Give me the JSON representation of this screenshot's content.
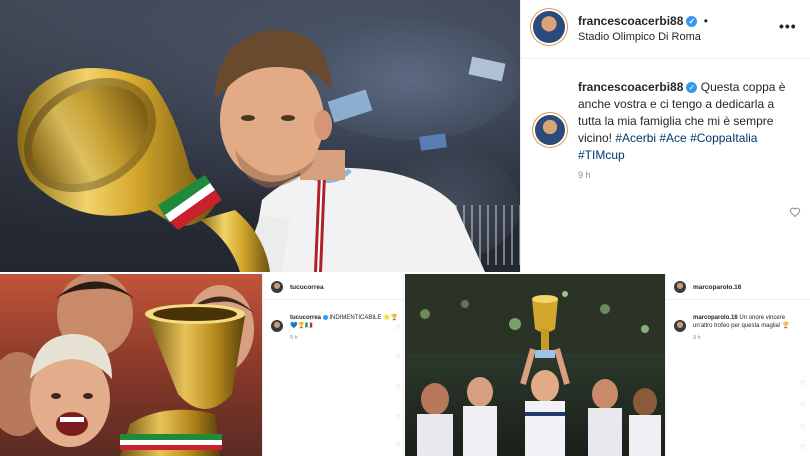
{
  "top_post": {
    "username": "francescoacerbi88",
    "location": "Stadio Olimpico Di Roma",
    "more_label": "•••",
    "follow_dot": "•",
    "caption": "Questa coppa è anche vostra e ci tengo a dedicarla a tutta la mia famiglia che mi è sempre vicino!",
    "hashtags": "#Acerbi #Ace #CoppaItalia #TIMcup",
    "time": "9 h",
    "verified_glyph": "✓",
    "like_icon": "heart-icon"
  },
  "bottom_left_post": {
    "username": "tucucorrea",
    "caption": "INDIMENTICABILE",
    "caption_emoji_1": "⭐🏆",
    "caption_emoji_2": "💙🏆🇮🇹",
    "time": "9 h"
  },
  "bottom_right_post": {
    "username": "marcoparolo.16",
    "caption": "Un onore vincere un'altro trofeo per questa maglia!",
    "caption_emoji": "🏆",
    "time": "9 h"
  },
  "colors": {
    "verified_blue": "#3897f0",
    "hashtag_blue": "#00376b",
    "meta_gray": "#8e8e8e",
    "trophy_gold": "#d4a72c"
  }
}
